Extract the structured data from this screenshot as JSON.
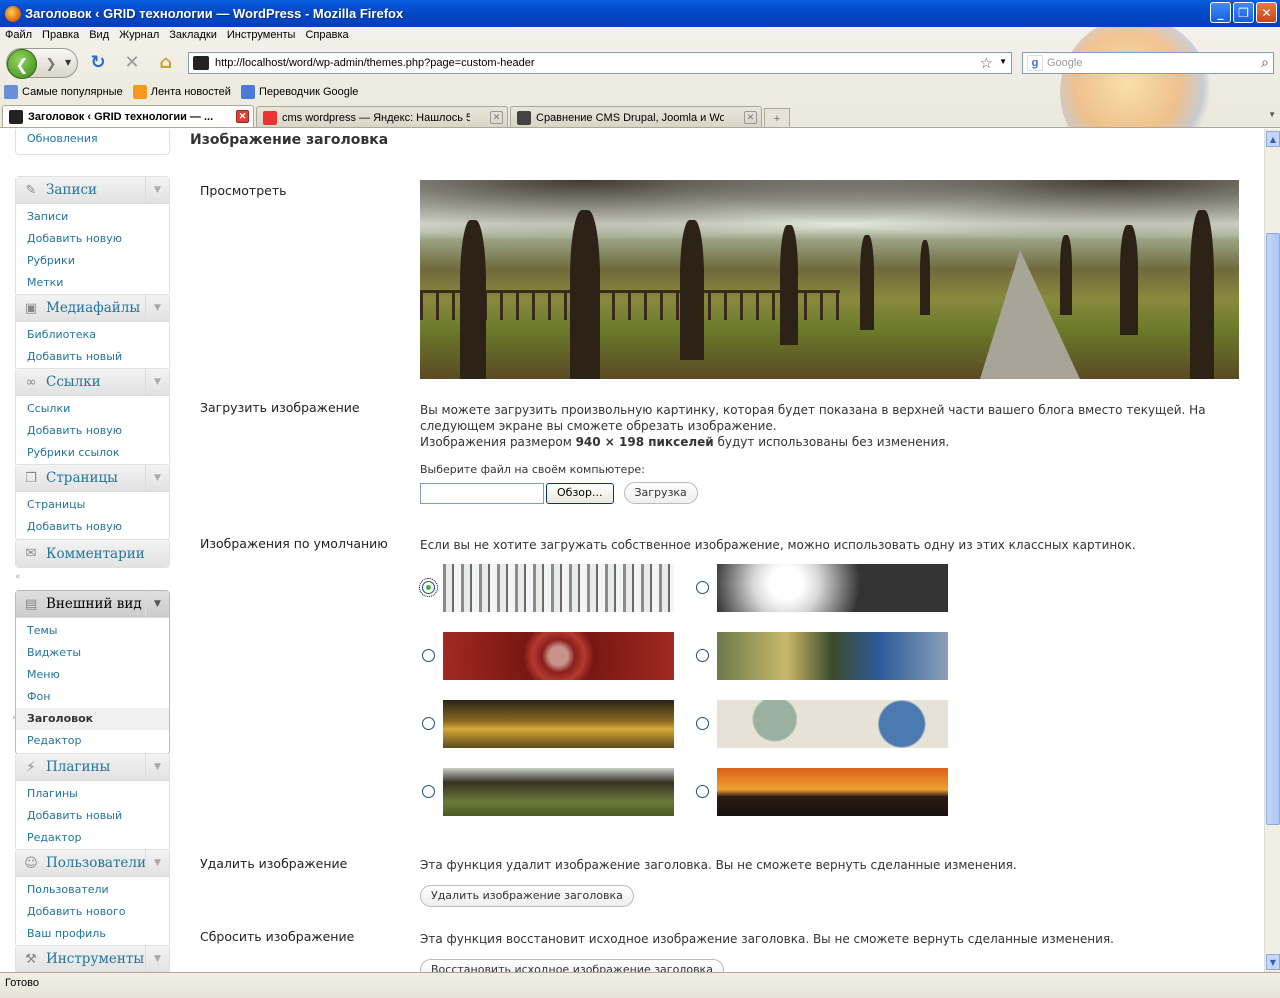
{
  "window": {
    "title": "Заголовок ‹ GRID технологии — WordPress - Mozilla Firefox"
  },
  "menubar": [
    "Файл",
    "Правка",
    "Вид",
    "Журнал",
    "Закладки",
    "Инструменты",
    "Справка"
  ],
  "url": "http://localhost/word/wp-admin/themes.php?page=custom-header",
  "search": {
    "placeholder": "Google"
  },
  "bookmarks": [
    "Самые популярные",
    "Лента новостей",
    "Переводчик Google"
  ],
  "tabs": [
    {
      "label": "Заголовок ‹ GRID технологии — ...",
      "active": true
    },
    {
      "label": "cms wordpress — Яндекс: Нашлось 5 ...",
      "active": false
    },
    {
      "label": "Сравнение CMS Drupal, Joomla и Wor...",
      "active": false
    }
  ],
  "sidebar": {
    "top_item": "Обновления",
    "groups": [
      {
        "name": "posts",
        "title": "Записи",
        "icon": "pin-icon",
        "items": [
          "Записи",
          "Добавить новую",
          "Рубрики",
          "Метки"
        ]
      },
      {
        "name": "media",
        "title": "Медиафайлы",
        "icon": "media-icon",
        "items": [
          "Библиотека",
          "Добавить новый"
        ]
      },
      {
        "name": "links",
        "title": "Ссылки",
        "icon": "link-icon",
        "items": [
          "Ссылки",
          "Добавить новую",
          "Рубрики ссылок"
        ]
      },
      {
        "name": "pages",
        "title": "Страницы",
        "icon": "pages-icon",
        "items": [
          "Страницы",
          "Добавить новую"
        ]
      },
      {
        "name": "comments",
        "title": "Комментарии",
        "icon": "comment-icon",
        "items": []
      },
      {
        "name": "appearance",
        "title": "Внешний вид",
        "icon": "appearance-icon",
        "items": [
          "Темы",
          "Виджеты",
          "Меню",
          "Фон",
          "Заголовок",
          "Редактор"
        ],
        "current": "Заголовок"
      },
      {
        "name": "plugins",
        "title": "Плагины",
        "icon": "plugin-icon",
        "items": [
          "Плагины",
          "Добавить новый",
          "Редактор"
        ]
      },
      {
        "name": "users",
        "title": "Пользователи",
        "icon": "users-icon",
        "items": [
          "Пользователи",
          "Добавить нового",
          "Ваш профиль"
        ]
      },
      {
        "name": "tools",
        "title": "Инструменты",
        "icon": "tools-icon",
        "items": []
      }
    ]
  },
  "main": {
    "heading": "Изображение заголовка",
    "preview_label": "Просмотреть",
    "upload_label": "Загрузить изображение",
    "upload_text1": "Вы можете загрузить произвольную картинку, которая будет показана в верхней части вашего блога вместо текущей. На следующем экране вы сможете обрезать изображение.",
    "upload_text2_pre": "Изображения размером ",
    "upload_text2_bold": "940 × 198 пикселей",
    "upload_text2_post": " будут использованы без изменения.",
    "choose_file": "Выберите файл на своём компьютере:",
    "browse_btn": "Обзор...",
    "upload_btn": "Загрузка",
    "defaults_label": "Изображения по умолчанию",
    "defaults_text": "Если вы не хотите загружать собственное изображение, можно использовать одну из этих классных картинок.",
    "default_images": [
      {
        "name": "berries",
        "selected": true
      },
      {
        "name": "cherryblossom",
        "selected": false
      },
      {
        "name": "concave",
        "selected": false
      },
      {
        "name": "fern",
        "selected": false
      },
      {
        "name": "forestfloor",
        "selected": false
      },
      {
        "name": "inkwell",
        "selected": false
      },
      {
        "name": "path",
        "selected": false
      },
      {
        "name": "sunset",
        "selected": false
      }
    ],
    "remove_label": "Удалить изображение",
    "remove_text": "Эта функция удалит изображение заголовка. Вы не сможете вернуть сделанные изменения.",
    "remove_btn": "Удалить изображение заголовка",
    "reset_label": "Сбросить изображение",
    "reset_text": "Эта функция восстановит исходное изображение заголовка. Вы не сможете вернуть сделанные изменения.",
    "reset_btn": "Восстановить исходное изображение заголовка"
  },
  "status": "Готово"
}
